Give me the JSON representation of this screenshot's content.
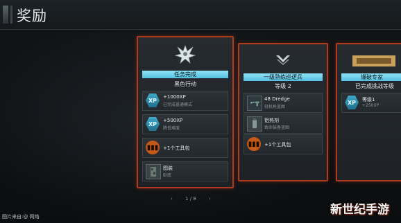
{
  "header": {
    "title": "奖励"
  },
  "cards": [
    {
      "banner": "任务完成",
      "subtitle": "黑色行动",
      "rows": [
        {
          "icon": "xp-icon",
          "glyph": "XP",
          "title": "+1000XP",
          "desc": "已完成普通模式"
        },
        {
          "icon": "xp-icon",
          "glyph": "XP",
          "title": "+500XP",
          "desc": "降低难度"
        },
        {
          "icon": "toolkit-icon",
          "glyph": "▮▮▮",
          "title": "+1个工具包",
          "desc": ""
        },
        {
          "icon": "camo-icon",
          "glyph": "",
          "title": "图装",
          "desc": "卧底"
        }
      ]
    },
    {
      "banner": "一级熟练巡逻兵",
      "subtitle": "等级 2",
      "rows": [
        {
          "icon": "weapon-icon",
          "glyph": "⌐╦",
          "title": "48 Dredge",
          "desc": "轻机枪蓝图"
        },
        {
          "icon": "gear-icon",
          "glyph": "",
          "title": "铝热剂",
          "desc": "致命装备蓝图"
        },
        {
          "icon": "toolkit-icon",
          "glyph": "▮▮▮",
          "title": "+1个工具包",
          "desc": ""
        }
      ]
    },
    {
      "banner": "爆破专家",
      "subtitle": "已完成挑战等级",
      "rows": [
        {
          "icon": "xp-icon",
          "glyph": "XP",
          "title": "等级1",
          "desc": "+250XP"
        }
      ]
    }
  ],
  "pager": {
    "prev": "‹",
    "label": "1 / 8",
    "next": "›"
  },
  "watermark": {
    "text": "新世纪手游",
    "left_text": "图片来自:@ 网络"
  },
  "colors": {
    "accent_border": "#b23a1c",
    "banner": "#8fe3f5",
    "xp": "#3fa9c8",
    "toolkit": "#c45a18"
  }
}
